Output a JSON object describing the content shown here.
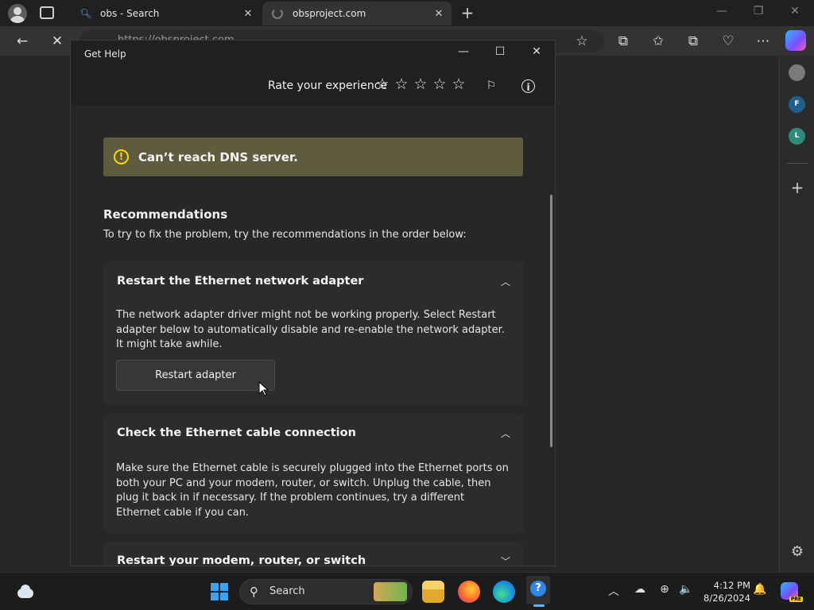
{
  "browser": {
    "tabs": [
      {
        "title": "obs - Search",
        "favicon": "search-icon"
      },
      {
        "title": "obsproject.com",
        "favicon": "loading-spinner-icon"
      }
    ],
    "address": "https://obsproject.com",
    "icons": {
      "back": "←",
      "stop": "✕",
      "star": "☆",
      "split": "⧉",
      "favorites": "✩",
      "collections": "⧉",
      "health": "♡",
      "more": "⋯",
      "tab_close": "✕",
      "new_tab": "+",
      "minimize": "—",
      "restore": "❐",
      "close": "✕"
    },
    "sidebar": {
      "items": [
        {
          "letter": "",
          "color": "#7a7a7a"
        },
        {
          "letter": "F",
          "color": "#1f5f8b"
        },
        {
          "letter": "L",
          "color": "#2e8b7a"
        }
      ],
      "plus": "+",
      "gear": "⚙"
    }
  },
  "get_help": {
    "window_title": "Get Help",
    "window_controls": {
      "minimize": "—",
      "maximize": "☐",
      "close": "✕"
    },
    "rate_label": "Rate your experience",
    "stars": [
      "☆",
      "☆",
      "☆",
      "☆",
      "☆"
    ],
    "feedback_icon": "⚐",
    "info_icon": "i",
    "alert": {
      "icon": "!",
      "text": "Can’t reach DNS server."
    },
    "recommendations": {
      "title": "Recommendations",
      "subtitle": "To try to fix the problem, try the recommendations in the order below:"
    },
    "cards": [
      {
        "title": "Restart the Ethernet network adapter",
        "chevron": "︿",
        "body": "The network adapter driver might not be working properly. Select Restart adapter below to automatically disable and re-enable the network adapter. It might take awhile.",
        "button": "Restart adapter"
      },
      {
        "title": "Check the Ethernet cable connection",
        "chevron": "︿",
        "body": "Make sure the Ethernet cable is securely plugged into the Ethernet ports on both your PC and your modem, router, or switch. Unplug the cable, then plug it back in if necessary. If the problem continues, try a different Ethernet cable if you can."
      },
      {
        "title": "Restart your modem, router, or switch",
        "chevron": "﹀"
      }
    ]
  },
  "taskbar": {
    "search_label": "Search",
    "search_glyph": "⚲",
    "time": "4:12 PM",
    "date": "8/26/2024",
    "tray": {
      "chevron": "︿",
      "onedrive": "☁",
      "network": "⊕",
      "volume": "🔈",
      "notifications": "🔔"
    },
    "help_glyph": "?"
  }
}
